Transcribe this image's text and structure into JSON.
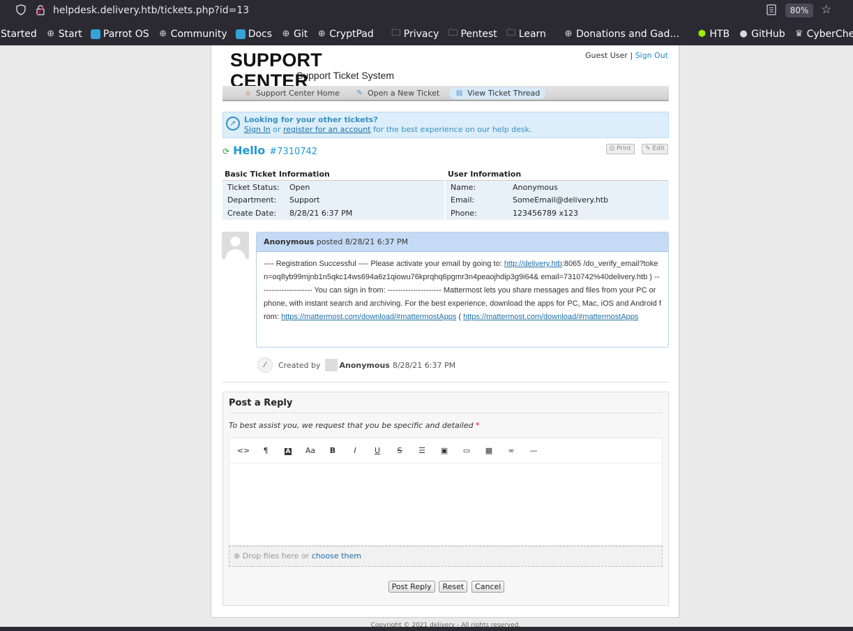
{
  "browser": {
    "url": "helpdesk.delivery.htb/tickets.php?id=13",
    "zoom": "80%",
    "bookmarks": [
      "Started",
      "Start",
      "Parrot OS",
      "Community",
      "Docs",
      "Git",
      "CryptPad",
      "Privacy",
      "Pentest",
      "Learn",
      "Donations and Gad…",
      "HTB",
      "GitHub",
      "CyberChef"
    ]
  },
  "header": {
    "logo_title": "SUPPORT CENTER",
    "logo_subtitle": "Support Ticket System",
    "user": "Guest User",
    "separator": "|",
    "sign_out": "Sign Out"
  },
  "nav": [
    "Support Center Home",
    "Open a New Ticket",
    "View Ticket Thread"
  ],
  "notice": {
    "title": "Looking for your other tickets?",
    "sign_in": "Sign In",
    "or": "or",
    "register": "register for an account",
    "rest": "for the best experience on our help desk."
  },
  "ticket": {
    "subject": "Hello",
    "number": "#7310742",
    "print": "Print",
    "edit": "Edit"
  },
  "basic_info": {
    "heading": "Basic Ticket Information",
    "rows": [
      {
        "k": "Ticket Status:",
        "v": "Open"
      },
      {
        "k": "Department:",
        "v": "Support"
      },
      {
        "k": "Create Date:",
        "v": "8/28/21 6:37 PM"
      }
    ]
  },
  "user_info": {
    "heading": "User Information",
    "rows": [
      {
        "k": "Name:",
        "v": "Anonymous"
      },
      {
        "k": "Email:",
        "v": "SomeEmail@delivery.htb"
      },
      {
        "k": "Phone:",
        "v": "123456789 x123"
      }
    ]
  },
  "message": {
    "author": "Anonymous",
    "posted": "posted 8/28/21 6:37 PM",
    "body_1": "---- Registration Successful ---- Please activate your email by going to: ",
    "link_1": "http://delivery.htb",
    "body_2": ":8065 /do_verify_email?token=oq8yb99mjnb1n5qkc14ws694a6z1qiowu76kprqhq6pgmr3n4peaojhdip3g9i64& email=7310742%40delivery.htb ) --------------------- You can sign in from: --------------------- Mattermost lets you share messages and files from your PC or phone, with instant search and archiving. For the best experience, download the apps for PC, Mac, iOS and Android from: ",
    "link_2": "https://mattermost.com/download/#mattermostApps",
    "body_3": " ( ",
    "link_3": "https://mattermost.com/download/#mattermostApps"
  },
  "event": {
    "created_by": "Created by",
    "user": "Anonymous",
    "time": "8/28/21 6:37 PM"
  },
  "reply": {
    "title": "Post a Reply",
    "subtitle": "To best assist you, we request that you be specific and detailed",
    "required": "*",
    "drop_text": "Drop files here or",
    "choose": "choose them",
    "post": "Post Reply",
    "reset": "Reset",
    "cancel": "Cancel"
  },
  "footer": {
    "copyright": "Copyright © 2021 delivery - All rights reserved."
  }
}
